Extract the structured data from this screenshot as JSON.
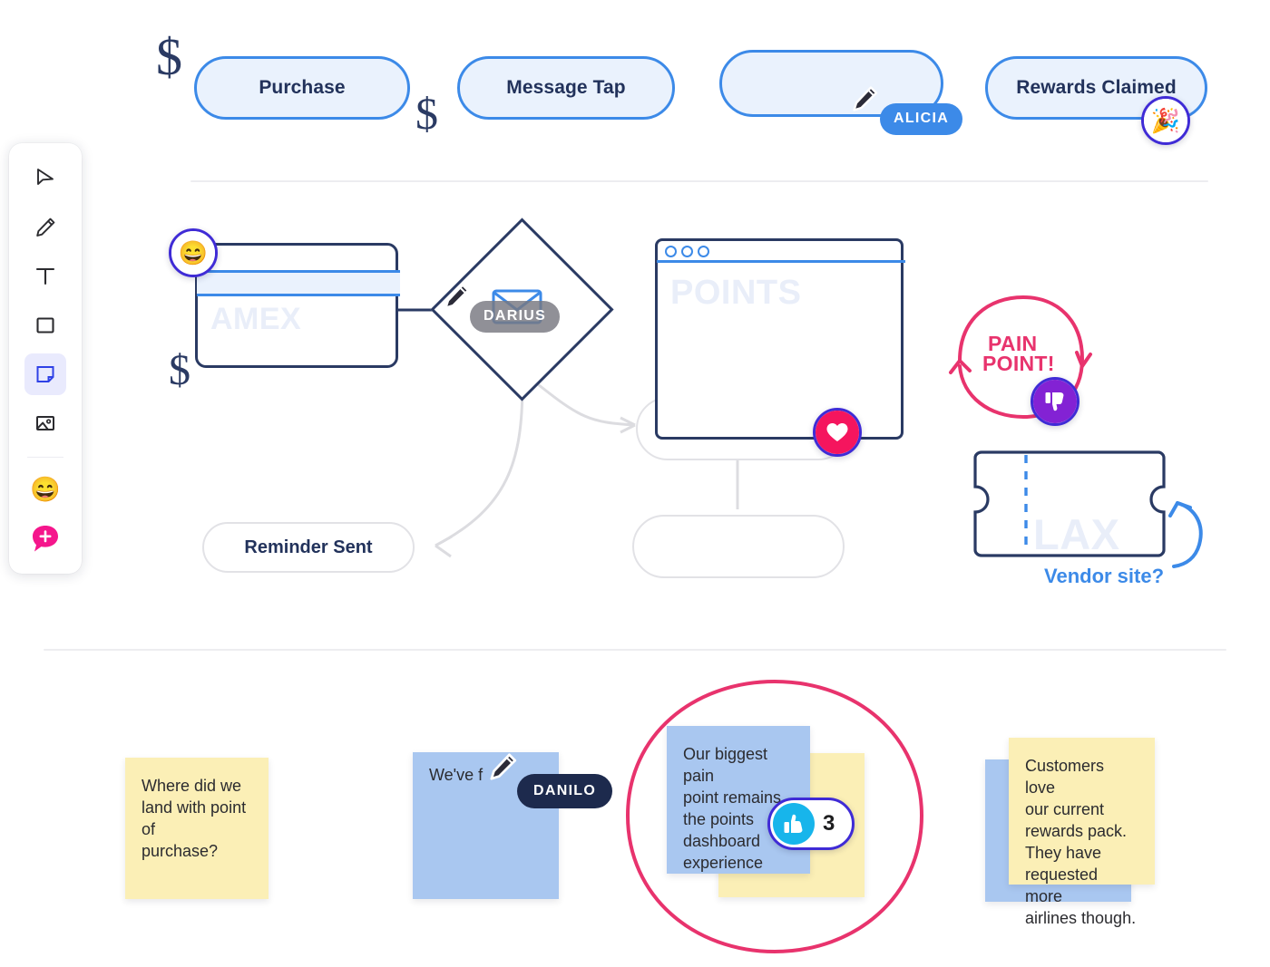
{
  "app": {
    "canvas_background": "#ffffff"
  },
  "toolbar": {
    "tools": [
      {
        "name": "select-tool",
        "icon": "cursor-arrow-icon",
        "active": false
      },
      {
        "name": "pen-tool",
        "icon": "pencil-icon",
        "active": false
      },
      {
        "name": "text-tool",
        "icon": "text-t-icon",
        "active": false
      },
      {
        "name": "shape-tool",
        "icon": "square-icon",
        "active": false
      },
      {
        "name": "sticky-tool",
        "icon": "sticky-note-icon",
        "active": true
      },
      {
        "name": "image-tool",
        "icon": "image-icon",
        "active": false
      },
      {
        "name": "emoji-tool",
        "icon": "grinning-face-emoji",
        "glyph": "😄",
        "active": false
      },
      {
        "name": "comment-tool",
        "icon": "comment-plus-icon",
        "active": false
      }
    ]
  },
  "flow_row": {
    "nodes": [
      {
        "id": "purchase",
        "label": "Purchase"
      },
      {
        "id": "message-tap",
        "label": "Message Tap"
      },
      {
        "id": "untitled",
        "label": ""
      },
      {
        "id": "rewards-claimed",
        "label": "Rewards Claimed"
      }
    ]
  },
  "shapes": {
    "credit_card_label": "AMEX",
    "browser_label": "POINTS",
    "ticket_label": "LAX",
    "reminder_pill_label": "Reminder Sent",
    "empty_pill_1_label": "",
    "empty_pill_2_label": ""
  },
  "annotations": {
    "pain_point": {
      "line1": "PAIN",
      "line2": "POINT!",
      "color": "#e8336d"
    },
    "vendor_site": {
      "text": "Vendor site?",
      "color": "#3c8ae8"
    },
    "dollar_doodles": [
      "$",
      "$",
      "$"
    ]
  },
  "collaborators": [
    {
      "name": "ALICIA",
      "color": "#3c8ae8",
      "cursor": "pencil-cursor"
    },
    {
      "name": "DARIUS",
      "color": "#8a8a8f",
      "cursor": "pencil-cursor"
    },
    {
      "name": "DANILO",
      "color": "#1d2a4d",
      "cursor": "pencil-cursor"
    }
  ],
  "reactions": [
    {
      "id": "grin-on-card",
      "emoji": "😄",
      "glyph_name": "grinning-face-emoji",
      "count": "",
      "bg": "#ffffff"
    },
    {
      "id": "party-on-rewards",
      "emoji": "🎉",
      "glyph_name": "party-popper-emoji",
      "count": "",
      "bg": "#ffffff"
    },
    {
      "id": "heart-on-browser",
      "emoji": "♥",
      "glyph_name": "heart-icon",
      "count": "",
      "bg": "#f5155e"
    },
    {
      "id": "thumbsdown-painpoint",
      "emoji": "👎",
      "glyph_name": "thumbs-down-icon",
      "count": "",
      "bg": "#8322d4"
    },
    {
      "id": "thumbsup-sticky",
      "emoji": "👍",
      "glyph_name": "thumbs-up-icon",
      "count": "3",
      "bg": "#17b5eb"
    }
  ],
  "sticky_notes": [
    {
      "id": "note-point-of-purchase",
      "color": "yellow",
      "text": "Where did we\nland with point of\npurchase?"
    },
    {
      "id": "note-danilo-typing",
      "color": "blue",
      "text": "We've f"
    },
    {
      "id": "note-pain-point",
      "color": "blue",
      "text": "Our biggest pain\npoint remains\nthe points\ndashboard\nexperience"
    },
    {
      "id": "note-behind-pain-point",
      "color": "yellow",
      "text": ""
    },
    {
      "id": "note-rewards-pack",
      "color": "yellow",
      "text": "Customers love\nour current\nrewards pack.\nThey have\nrequested more\nairlines though."
    },
    {
      "id": "note-behind-rewards",
      "color": "blue",
      "text": ""
    }
  ],
  "colors": {
    "accent_blue": "#3c8ae8",
    "node_fill": "#eaf2fd",
    "navy": "#22325b",
    "pink": "#e8336d",
    "purple_ring": "#3f2bd6",
    "sticky_yellow": "#fbefb6",
    "sticky_blue": "#a9c7f0"
  }
}
